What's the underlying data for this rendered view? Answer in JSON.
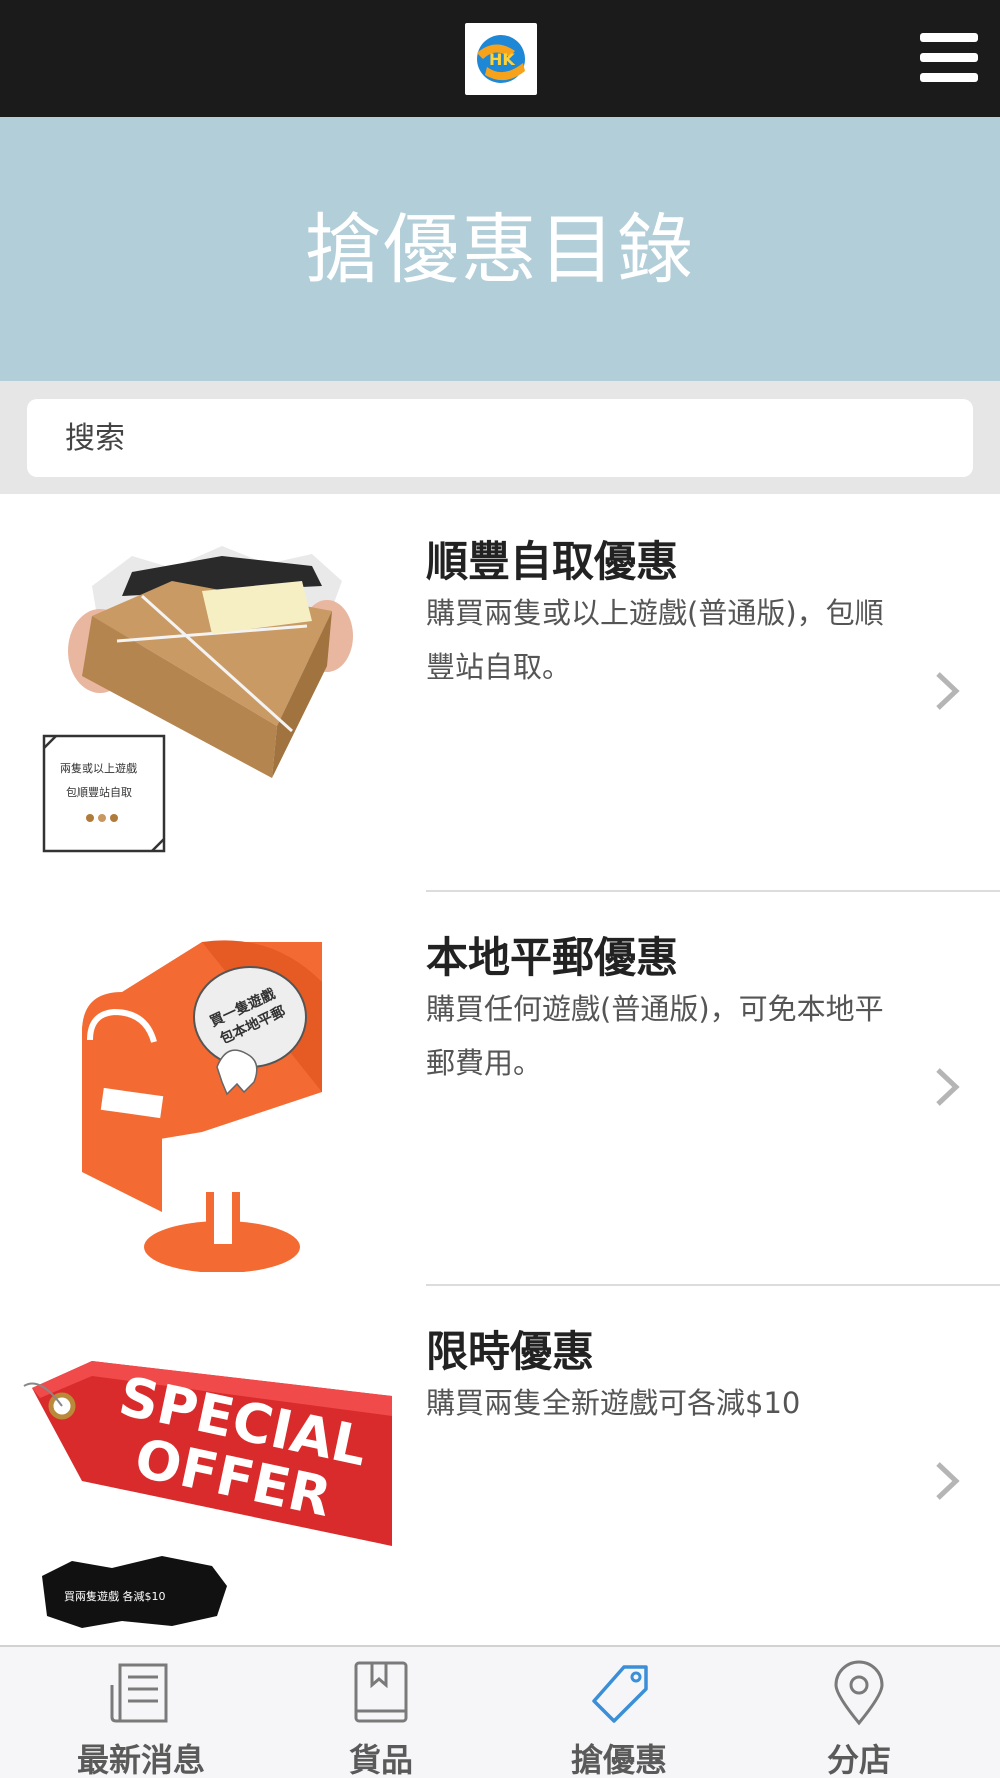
{
  "header": {
    "logo_icon": "hk-game-logo",
    "menu_icon": "hamburger-menu-icon"
  },
  "banner": {
    "title": "搶優惠目錄"
  },
  "search": {
    "placeholder": "搜索"
  },
  "offers": [
    {
      "title": "順豐自取優惠",
      "desc": "購買兩隻或以上遊戲(普通版)，包順豐站自取。",
      "image_icon": "parcel-box-image",
      "image_caption_1": "兩隻或以上遊戲",
      "image_caption_2": "包順豐站自取"
    },
    {
      "title": "本地平郵優惠",
      "desc": "購買任何遊戲(普通版)，可免本地平郵費用。",
      "image_icon": "mailbox-image",
      "image_caption_1": "買一隻遊戲",
      "image_caption_2": "包本地平郵"
    },
    {
      "title": "限時優惠",
      "desc": "購買兩隻全新遊戲可各減$10",
      "image_icon": "special-offer-tag-image",
      "image_caption_1": "SPECIAL",
      "image_caption_2": "OFFER",
      "image_caption_3": "買兩隻遊戲 各減$10"
    }
  ],
  "bottom_nav": [
    {
      "label": "最新消息",
      "icon": "newspaper-icon"
    },
    {
      "label": "貨品",
      "icon": "book-icon"
    },
    {
      "label": "搶優惠",
      "icon": "tag-icon",
      "active": true
    },
    {
      "label": "分店",
      "icon": "location-pin-icon"
    }
  ],
  "colors": {
    "topbar": "#1b1b1b",
    "banner": "#b1ced9",
    "active_nav": "#3a8fd8",
    "offer_orange": "#f36a32",
    "offer_red": "#d92b2b"
  }
}
